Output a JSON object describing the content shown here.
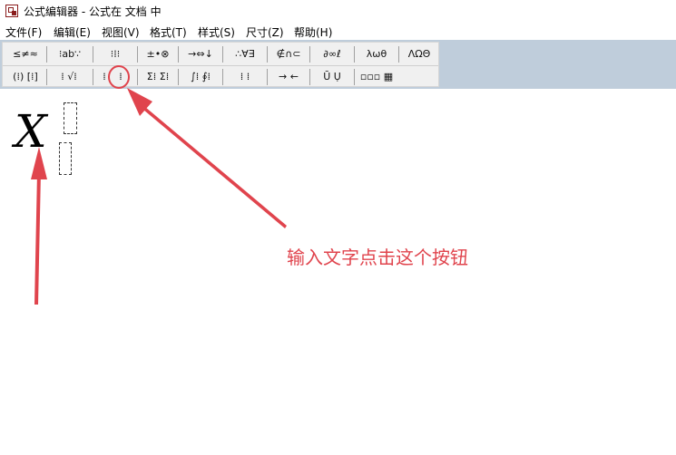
{
  "window": {
    "title": "公式编辑器 - 公式在 文档 中",
    "icon": "formula-editor-icon"
  },
  "menu": [
    {
      "label": "文件(F)"
    },
    {
      "label": "编辑(E)"
    },
    {
      "label": "视图(V)"
    },
    {
      "label": "格式(T)"
    },
    {
      "label": "样式(S)"
    },
    {
      "label": "尺寸(Z)"
    },
    {
      "label": "帮助(H)"
    }
  ],
  "toolbar": {
    "row1": [
      {
        "label": "≤≠≈"
      },
      {
        "label": "⁝ab∵"
      },
      {
        "label": "⁝⁞⁝"
      },
      {
        "label": "±•⊗"
      },
      {
        "label": "→⇔↓"
      },
      {
        "label": "∴∀∃"
      },
      {
        "label": "∉∩⊂"
      },
      {
        "label": "∂∞ℓ"
      },
      {
        "label": "λωθ"
      },
      {
        "label": "ΛΩΘ"
      }
    ],
    "row2": [
      {
        "label": "(⁞) [⁞]"
      },
      {
        "label": "⁞ √⁞"
      },
      {
        "label": "⁞"
      },
      {
        "label": "⁞"
      },
      {
        "label": "Σ⁞ Σ⁞"
      },
      {
        "label": "∫⁞ ∮⁞"
      },
      {
        "label": "⁞ ⁞"
      },
      {
        "label": "→ ←"
      },
      {
        "label": "Ū Ụ"
      },
      {
        "label": "▫▫▫ ▦"
      }
    ]
  },
  "canvas": {
    "variable": "X"
  },
  "annotation": {
    "text": "输入文字点击这个按钮",
    "color": "#e0444d"
  }
}
